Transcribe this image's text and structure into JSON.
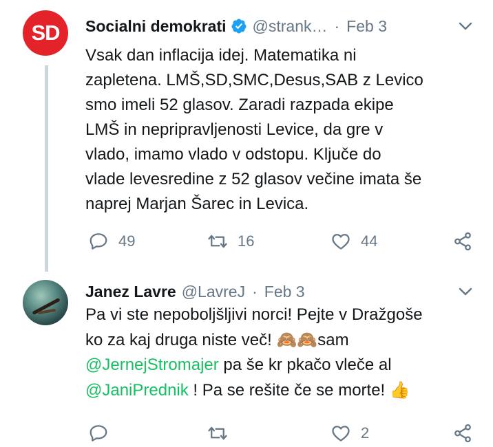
{
  "tweets": [
    {
      "author": {
        "name": "Socialni demokrati",
        "handle": "@strank…",
        "verified": true,
        "avatar_text": "SD",
        "avatar_color": "#e3222a"
      },
      "separator": "·",
      "date": "Feb 3",
      "text_lines": [
        "Vsak dan inflacija idej. Matematika ni",
        "zapletena. LMŠ,SD,SMC,Desus,SAB z Levico",
        "smo imeli 52 glasov. Zaradi razpada ekipe",
        "LMŠ in nepripravljenosti Levice, da gre v",
        "vlado, imamo vlado v odstopu. Ključe do",
        "vlade levesredine z 52 glasov večine imata še",
        "naprej Marjan Šarec in Levica."
      ],
      "stats": {
        "replies": "49",
        "retweets": "16",
        "likes": "44"
      }
    },
    {
      "author": {
        "name": "Janez Lavre",
        "handle": "@LavreJ",
        "verified": false
      },
      "separator": "·",
      "date": "Feb 3",
      "text": {
        "line1": "Pa vi ste nepoboljšljivi norci! Pejte v Dražgoše",
        "line2_a": "ko za kaj druga niste več! ",
        "emoji_monkeys": "🙈🙈",
        "line2_b": "sam",
        "mention1": "@JernejStromajer",
        "line3_rest": " pa še kr pkačo vleče al",
        "mention2": "@JaniPrednik",
        "line4_rest": " ! Pa se rešite če se morte! ",
        "emoji_thumb": "👍"
      },
      "stats": {
        "replies": "",
        "retweets": "",
        "likes": "2"
      }
    }
  ],
  "icons": {
    "reply": "reply-icon",
    "retweet": "retweet-icon",
    "like": "heart-icon",
    "share": "share-icon",
    "more": "chevron-down-icon",
    "verified": "verified-badge-icon"
  },
  "colors": {
    "text": "#14171a",
    "secondary": "#657786",
    "mention": "#17bf63",
    "verified": "#1da1f2",
    "thread_line": "#ccd6dd"
  }
}
